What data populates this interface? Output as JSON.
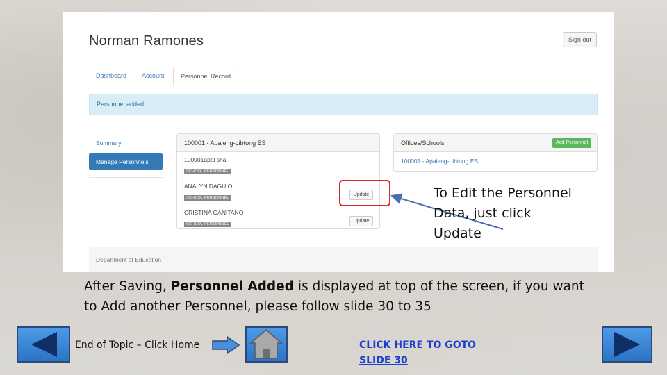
{
  "screenshot": {
    "user_name": "Norman Ramones",
    "signout_label": "Sign out",
    "tabs": [
      {
        "label": "Dashboard"
      },
      {
        "label": "Account"
      },
      {
        "label": "Personnel Record"
      }
    ],
    "alert_text": "Personnel added.",
    "sidenav": [
      {
        "label": "Summary"
      },
      {
        "label": "Manage Personnels"
      }
    ],
    "personnel_panel": {
      "title": "100001 - Apaleng-Libtong ES",
      "people": [
        {
          "name": "100001apal sha",
          "role": "SCHOOL PERSONNEL",
          "update_label": ""
        },
        {
          "name": "ANALYN DAGUIO",
          "role": "SCHOOL PERSONNEL",
          "update_label": "Update"
        },
        {
          "name": "CRISTINA GANITANO",
          "role": "SCHOOL PERSONNEL",
          "update_label": "Update"
        }
      ]
    },
    "offices_panel": {
      "title": "Offices/Schools",
      "add_label": "Add Personnel",
      "office": "100001 - Apaleng-Libtong ES"
    },
    "footer_text": "Department of Education"
  },
  "callout_text": "To Edit the Personnel Data, just click Update",
  "caption": {
    "part1": "After Saving, ",
    "bold": "Personnel Added",
    "part2": " is displayed at top of the screen, if you want to Add another Personnel, please follow slide 30 to 35"
  },
  "nav": {
    "end_of_topic_label": "End of Topic – Click Home",
    "goto_label": "CLICK HERE TO GOTO SLIDE 30"
  },
  "colors": {
    "primary_blue": "#337ab7",
    "alert_bg": "#d9edf7",
    "success_green": "#5cb85c",
    "highlight_red": "#e1262a",
    "nav_blue": "#2c73c6",
    "link_blue": "#1c3fd0"
  }
}
